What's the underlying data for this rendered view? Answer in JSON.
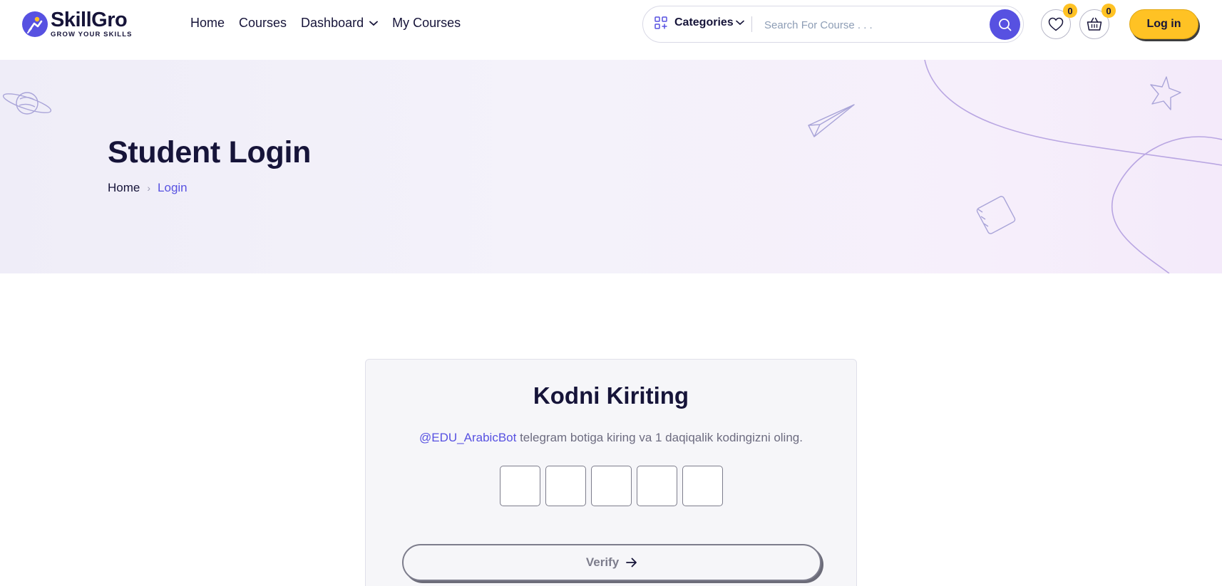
{
  "brand": {
    "name": "SkillGro",
    "tagline": "GROW YOUR SKILLS",
    "accent": "#5751e1",
    "yellow": "#ffc224",
    "dark": "#161439"
  },
  "nav": [
    {
      "label": "Home"
    },
    {
      "label": "Courses"
    },
    {
      "label": "Dashboard",
      "has_dropdown": true
    },
    {
      "label": "My Courses"
    }
  ],
  "search": {
    "categories_label": "Categories",
    "placeholder": "Search For Course . . ."
  },
  "wishlist": {
    "icon": "heart-icon",
    "count": "0"
  },
  "cart": {
    "icon": "basket-icon",
    "count": "0"
  },
  "login_button": "Log in",
  "banner": {
    "title": "Student Login",
    "breadcrumb": {
      "home": "Home",
      "current": "Login"
    }
  },
  "verify_card": {
    "title": "Kodni Kiriting",
    "bot_handle": "@EDU_ArabicBot",
    "instruction": " telegram botiga kiring va 1 daqiqalik kodingizni oling.",
    "code_digits": [
      "",
      "",
      "",
      "",
      ""
    ],
    "verify_label": "Verify"
  }
}
